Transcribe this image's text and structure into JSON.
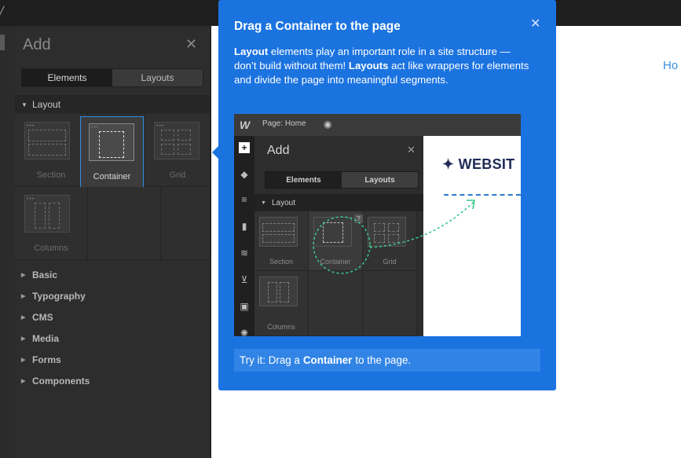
{
  "topbar": {
    "partial_logo": "/"
  },
  "panel": {
    "title": "Add",
    "close_glyph": "✕",
    "tabs": [
      {
        "label": "Elements",
        "active": true
      },
      {
        "label": "Layouts",
        "active": false
      }
    ],
    "layout_section": "Layout",
    "layout_items": [
      {
        "label": "Section",
        "selected": false
      },
      {
        "label": "Container",
        "selected": true
      },
      {
        "label": "Grid",
        "selected": false
      },
      {
        "label": "Columns",
        "selected": false
      }
    ],
    "categories": [
      "Basic",
      "Typography",
      "CMS",
      "Media",
      "Forms",
      "Components"
    ]
  },
  "canvas": {
    "nav_link": "Ho"
  },
  "popover": {
    "title": "Drag a Container to the page",
    "close_glyph": "✕",
    "body_b1": "Layout",
    "body_t1": " elements play an important role in a site structure — don’t build without them! ",
    "body_b2": "Layouts",
    "body_t2": " act like wrappers for elements and divide the page into meaningful segments.",
    "try_prefix": "Try it: Drag a ",
    "try_bold": "Container",
    "try_suffix": " to the page."
  },
  "illustration": {
    "logo": "W",
    "page_label": "Page: Home",
    "panel_title": "Add",
    "close_glyph": "✕",
    "tabs": [
      "Elements",
      "Layouts"
    ],
    "section": "Layout",
    "items": [
      "Section",
      "Container",
      "Grid",
      "Columns"
    ],
    "help_badge": "?",
    "brand": "✦ WEBSIT"
  },
  "colors": {
    "accent": "#1b73e0",
    "selection": "#2d8fe6",
    "link": "#3b8fde",
    "drag_path": "#39c78a"
  }
}
